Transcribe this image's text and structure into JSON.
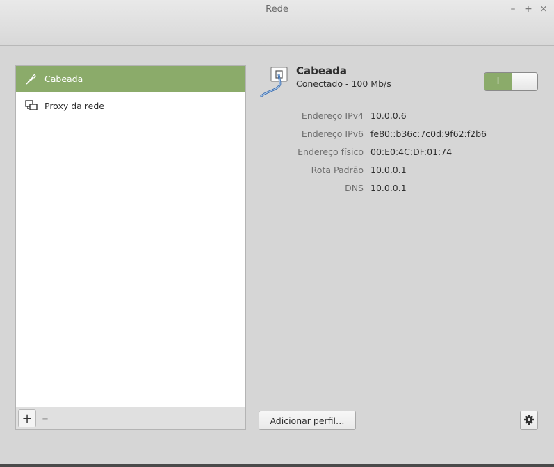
{
  "window": {
    "title": "Rede",
    "minimize": "–",
    "maximize": "+",
    "close": "×"
  },
  "sidebar": {
    "items": [
      {
        "label": "Cabeada",
        "icon": "ethernet-plug-icon",
        "selected": true
      },
      {
        "label": "Proxy da rede",
        "icon": "network-proxy-icon",
        "selected": false
      }
    ],
    "add_label": "+",
    "remove_label": "–"
  },
  "connection": {
    "name": "Cabeada",
    "status": "Conectado - 100 Mb/s",
    "switch_on_label": "I",
    "enabled": true
  },
  "details": [
    {
      "label": "Endereço IPv4",
      "value": "10.0.0.6"
    },
    {
      "label": "Endereço IPv6",
      "value": "fe80::b36c:7c0d:9f62:f2b6"
    },
    {
      "label": "Endereço físico",
      "value": "00:E0:4C:DF:01:74"
    },
    {
      "label": "Rota Padrão",
      "value": "10.0.0.1"
    },
    {
      "label": "DNS",
      "value": "10.0.0.1"
    }
  ],
  "footer": {
    "add_profile_label": "Adicionar perfil…",
    "settings_icon": "gear-icon"
  },
  "colors": {
    "accent": "#8bab6a",
    "background": "#d6d6d6"
  }
}
